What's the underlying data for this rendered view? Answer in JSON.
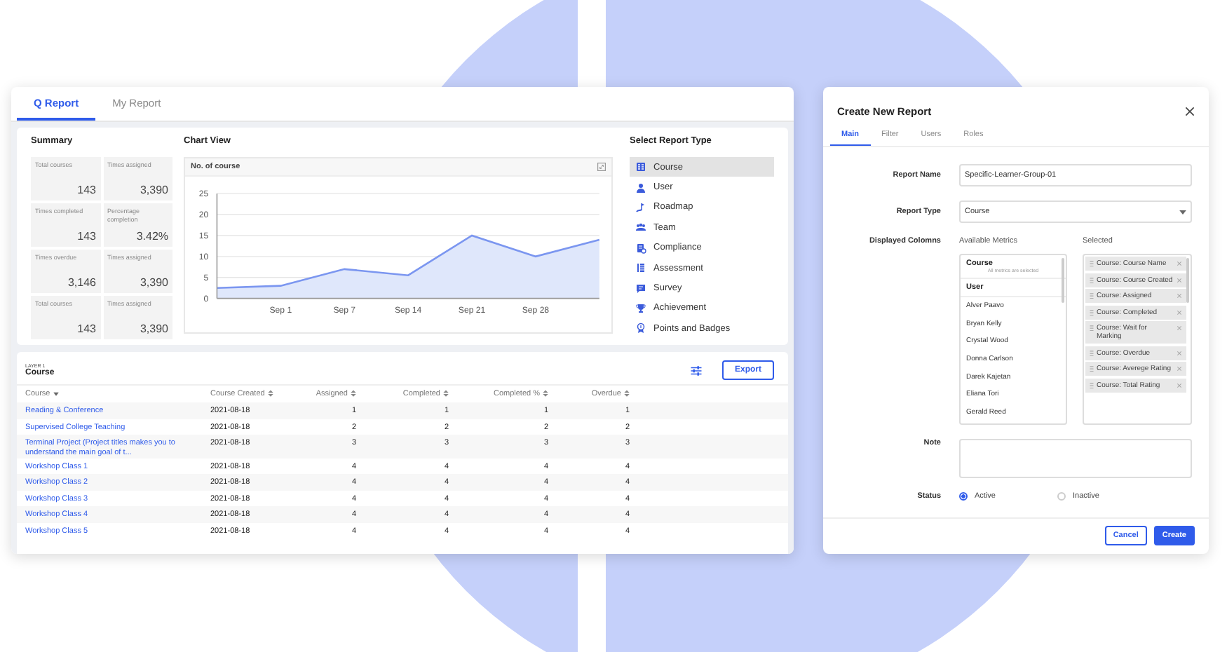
{
  "report_card": {
    "tabs": [
      {
        "label": "Q Report",
        "selected": true
      },
      {
        "label": "My Report",
        "selected": false
      }
    ],
    "summary": {
      "title": "Summary",
      "tiles": [
        {
          "label": "Total courses",
          "value": "143"
        },
        {
          "label": "Times assigned",
          "value": "3,390"
        },
        {
          "label": "Times completed",
          "value": "143"
        },
        {
          "label": "Percentage completion",
          "value": "3.42%"
        },
        {
          "label": "Times overdue",
          "value": "3,146"
        },
        {
          "label": "Times assigned",
          "value": "3,390"
        },
        {
          "label": "Total courses",
          "value": "143"
        },
        {
          "label": "Times assigned",
          "value": "3,390"
        }
      ]
    },
    "chart": {
      "title": "Chart View",
      "chart_data": {
        "type": "area",
        "title": "No. of course",
        "categories": [
          null,
          "Sep 1",
          "Sep 7",
          "Sep 14",
          "Sep 21",
          "Sep 28",
          null
        ],
        "ylim": [
          0,
          25
        ],
        "grid": true,
        "yticks": [
          0,
          5,
          10,
          15,
          20,
          25
        ],
        "series": [
          {
            "color": "#7b96f0",
            "values": [
              2.5,
              3,
              7,
              5.5,
              15,
              10,
              14
            ]
          }
        ]
      }
    },
    "report_types": {
      "title": "Select Report Type",
      "items": [
        {
          "label": "Course",
          "selected": true
        },
        {
          "label": "User",
          "selected": false
        },
        {
          "label": "Roadmap",
          "selected": false
        },
        {
          "label": "Team",
          "selected": false
        },
        {
          "label": "Compliance",
          "selected": false
        },
        {
          "label": "Assessment",
          "selected": false
        },
        {
          "label": "Survey",
          "selected": false
        },
        {
          "label": "Achievement",
          "selected": false
        },
        {
          "label": "Points and Badges",
          "selected": false
        }
      ]
    },
    "table": {
      "layer": "LAYER 1",
      "title": "Course",
      "export": "Export",
      "columns": [
        {
          "label": "Course",
          "sorted": true
        },
        {
          "label": "Course Created",
          "sorted": false
        },
        {
          "label": "Assigned",
          "sorted": false
        },
        {
          "label": "Completed",
          "sorted": false
        },
        {
          "label": "Completed %",
          "sorted": false
        },
        {
          "label": "Overdue",
          "sorted": false
        }
      ],
      "rows": [
        [
          "Reading & Conference",
          "2021-08-18",
          "1",
          "1",
          "1",
          "1"
        ],
        [
          "Supervised College Teaching",
          "2021-08-18",
          "2",
          "2",
          "2",
          "2"
        ],
        [
          "Terminal Project (Project titles makes you to understand the main goal of t...",
          "2021-08-18",
          "3",
          "3",
          "3",
          "3"
        ],
        [
          "Workshop Class 1",
          "2021-08-18",
          "4",
          "4",
          "4",
          "4"
        ],
        [
          "Workshop Class 2",
          "2021-08-18",
          "4",
          "4",
          "4",
          "4"
        ],
        [
          "Workshop Class 3",
          "2021-08-18",
          "4",
          "4",
          "4",
          "4"
        ],
        [
          "Workshop Class 4",
          "2021-08-18",
          "4",
          "4",
          "4",
          "4"
        ],
        [
          "Workshop Class 5",
          "2021-08-18",
          "4",
          "4",
          "4",
          "4"
        ]
      ]
    }
  },
  "dialog": {
    "title": "Create New Report",
    "tabs": [
      {
        "label": "Main",
        "selected": true
      },
      {
        "label": "Filter",
        "selected": false
      },
      {
        "label": "Users",
        "selected": false
      },
      {
        "label": "Roles",
        "selected": false
      }
    ],
    "report_name": {
      "label": "Report Name",
      "value": "Specific-Learner-Group-01"
    },
    "report_type": {
      "label": "Report Type",
      "value": "Course"
    },
    "columns": {
      "label": "Displayed Colomns",
      "available_title": "Available Metrics",
      "selected_title": "Selected",
      "available": [
        {
          "heading": "Course",
          "note": "All metrics are selected"
        },
        {
          "heading": "User",
          "items": [
            "Alver Paavo",
            "Bryan Kelly",
            "Crystal Wood",
            "Donna Carlson",
            "Darek Kajetan",
            "Eliana Tori",
            "Gerald Reed"
          ]
        }
      ],
      "selected": [
        "Course: Course Name",
        "Course: Course Created",
        "Course: Assigned",
        "Course: Completed",
        "Course: Wait for Marking",
        "Course: Overdue",
        "Course: Averege Rating",
        "Course: Total Rating"
      ]
    },
    "note": {
      "label": "Note"
    },
    "status": {
      "label": "Status",
      "options": [
        {
          "label": "Active",
          "selected": true
        },
        {
          "label": "Inactive",
          "selected": false
        }
      ]
    },
    "buttons": {
      "cancel": "Cancel",
      "create": "Create"
    }
  }
}
